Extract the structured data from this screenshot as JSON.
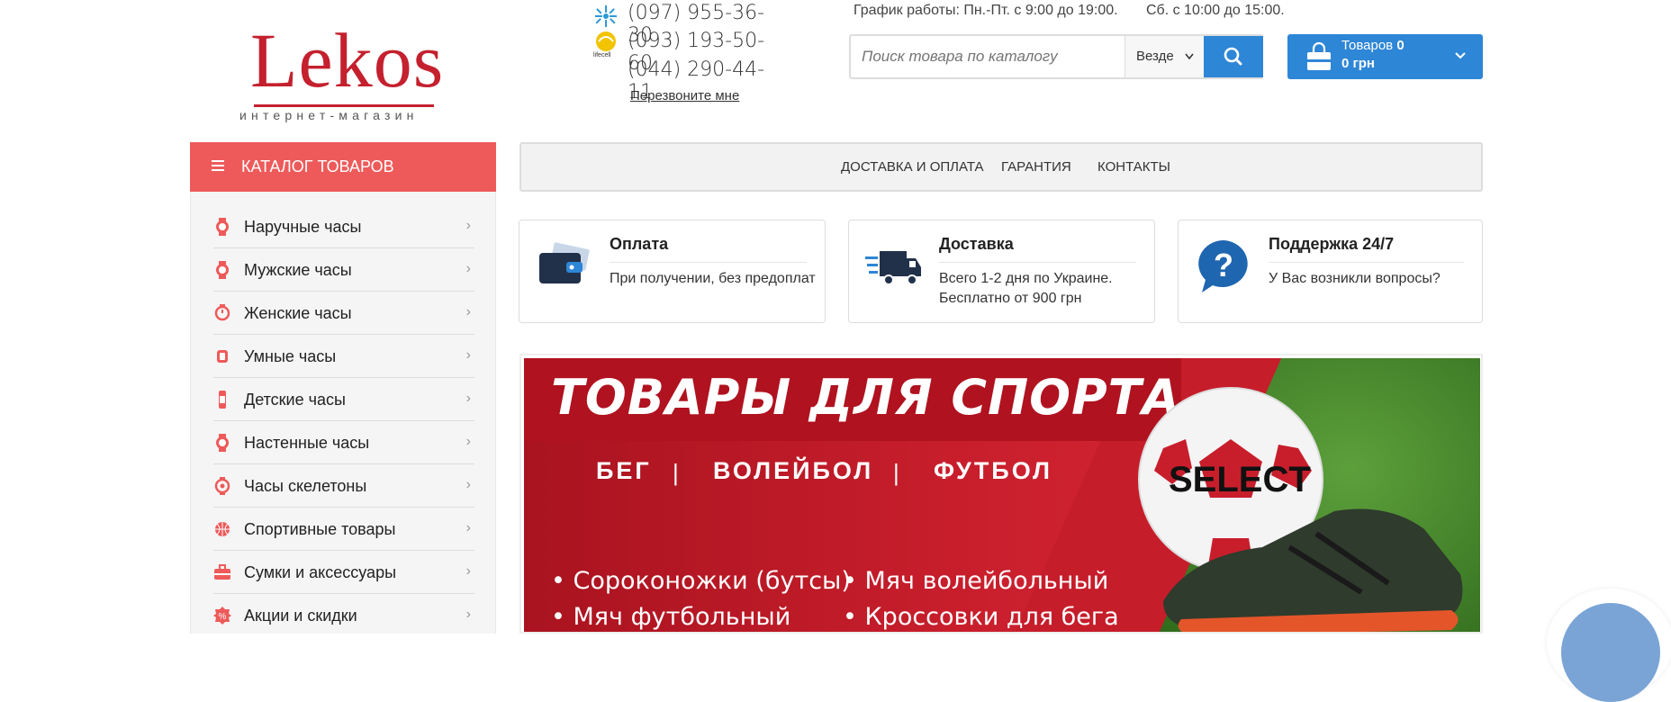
{
  "logo": {
    "word": "Lekos",
    "tagline": "интернет-магазин"
  },
  "phones": [
    {
      "operator": "kyivstar",
      "number": "(097) 955-36-30"
    },
    {
      "operator": "lifecell",
      "number": "(093) 193-50-60"
    },
    {
      "operator": "none",
      "number": "(044) 290-44-11"
    }
  ],
  "callback_label": "Перезвоните мне",
  "schedule": {
    "weekdays": "График работы: Пн.-Пт. с 9:00 до 19:00.",
    "saturday": "Сб. с 10:00 до 15:00."
  },
  "search": {
    "placeholder": "Поиск товара по каталогу",
    "scope": "Везде",
    "icon": "search-icon"
  },
  "cart": {
    "label": "Товаров",
    "count": "0",
    "total": "0 грн",
    "icon": "shopping-bag-icon"
  },
  "catalog": {
    "title": "КАТАЛОГ ТОВАРОВ",
    "items": [
      {
        "label": "Наручные часы",
        "icon": "wristwatch-icon"
      },
      {
        "label": "Мужские часы",
        "icon": "mens-watch-icon"
      },
      {
        "label": "Женские часы",
        "icon": "womens-watch-icon"
      },
      {
        "label": "Умные часы",
        "icon": "smartwatch-icon"
      },
      {
        "label": "Детские часы",
        "icon": "kids-watch-icon"
      },
      {
        "label": "Настенные часы",
        "icon": "wall-clock-icon"
      },
      {
        "label": "Часы скелетоны",
        "icon": "skeleton-watch-icon"
      },
      {
        "label": "Спортивные товары",
        "icon": "basketball-icon"
      },
      {
        "label": "Сумки и аксессуары",
        "icon": "bag-icon"
      },
      {
        "label": "Акции и скидки",
        "icon": "discount-icon"
      }
    ]
  },
  "topnav": [
    "ДОСТАВКА И ОПЛАТА",
    "ГАРАНТИЯ",
    "КОНТАКТЫ"
  ],
  "info_boxes": [
    {
      "title": "Оплата",
      "text": "При получении, без предоплат",
      "icon": "wallet-icon"
    },
    {
      "title": "Доставка",
      "text": "Всего 1-2 дня по Украине. Бесплатно от 900 грн",
      "icon": "delivery-truck-icon"
    },
    {
      "title": "Поддержка 24/7",
      "text": "У Вас возникли вопросы?",
      "icon": "question-bubble-icon"
    }
  ],
  "banner": {
    "title": "ТОВАРЫ ДЛЯ СПОРТА",
    "categories": [
      "БЕГ",
      "ВОЛЕЙБОЛ",
      "ФУТБОЛ"
    ],
    "separator": "|",
    "bullets": [
      "Сороконожки (бутсы)",
      "Мяч волейбольный",
      "Мяч футбольный",
      "Кроссовки для бега"
    ],
    "ball_brand": "SELECT"
  },
  "colors": {
    "brand_red": "#c4202e",
    "catalog_red": "#ee5a5a",
    "accent_blue": "#2e86d6"
  }
}
